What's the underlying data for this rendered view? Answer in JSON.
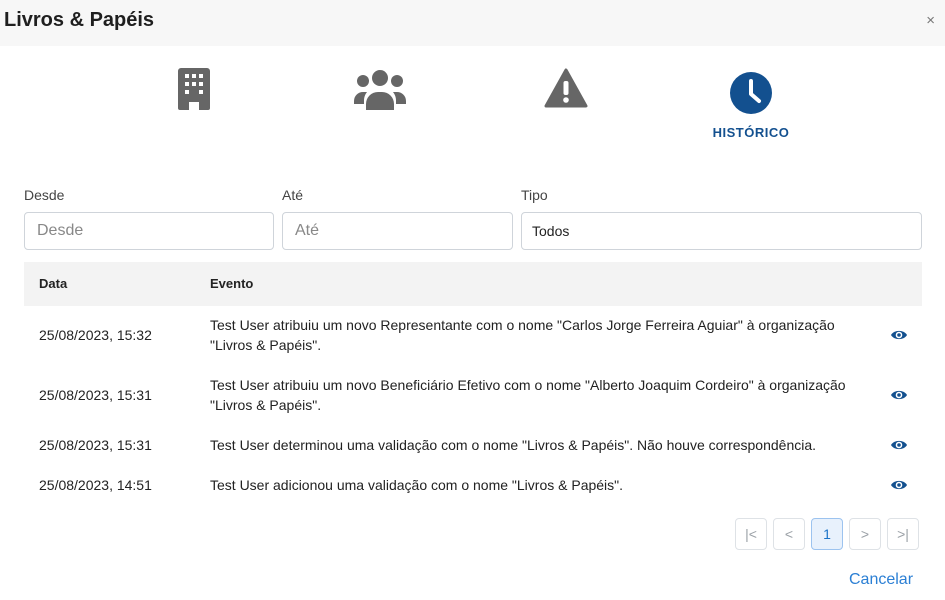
{
  "dialog": {
    "title": "Livros & Papéis",
    "close_label": "×"
  },
  "tabs": [
    {
      "icon": "building-icon",
      "label": ""
    },
    {
      "icon": "users-icon",
      "label": ""
    },
    {
      "icon": "warning-icon",
      "label": ""
    },
    {
      "icon": "clock-icon",
      "label": "HISTÓRICO",
      "active": true
    }
  ],
  "filters": {
    "desde": {
      "label": "Desde",
      "placeholder": "Desde",
      "value": ""
    },
    "ate": {
      "label": "Até",
      "placeholder": "Até",
      "value": ""
    },
    "tipo": {
      "label": "Tipo",
      "value": "Todos"
    }
  },
  "table": {
    "columns": [
      "Data",
      "Evento"
    ],
    "rows": [
      {
        "date": "25/08/2023, 15:32",
        "event": "Test User atribuiu um novo Representante com o nome \"Carlos Jorge Ferreira Aguiar\" à organização \"Livros & Papéis\"."
      },
      {
        "date": "25/08/2023, 15:31",
        "event": "Test User atribuiu um novo Beneficiário Efetivo com o nome \"Alberto Joaquim Cordeiro\" à organização \"Livros & Papéis\"."
      },
      {
        "date": "25/08/2023, 15:31",
        "event": "Test User determinou uma validação com o nome \"Livros & Papéis\". Não houve correspondência."
      },
      {
        "date": "25/08/2023, 14:51",
        "event": "Test User adicionou uma validação com o nome \"Livros & Papéis\"."
      }
    ]
  },
  "pagination": {
    "first": "|<",
    "prev": "<",
    "current": "1",
    "next": ">",
    "last": ">|"
  },
  "footer": {
    "cancel_label": "Cancelar"
  },
  "colors": {
    "accent": "#13508f",
    "icon_gray": "#666666",
    "link": "#2b7fd4"
  }
}
